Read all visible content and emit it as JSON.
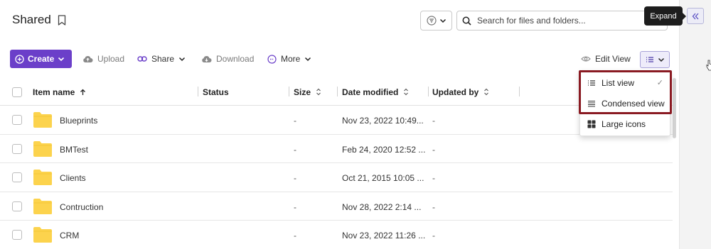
{
  "header": {
    "title": "Shared",
    "search_placeholder": "Search for files and folders...",
    "tooltip": "Expand"
  },
  "toolbar": {
    "create": "Create",
    "upload": "Upload",
    "share": "Share",
    "download": "Download",
    "more": "More",
    "edit_view": "Edit View"
  },
  "table": {
    "columns": [
      "Item name",
      "Status",
      "Size",
      "Date modified",
      "Updated by"
    ],
    "rows": [
      {
        "name": "Blueprints",
        "size": "-",
        "date": "Nov 23, 2022 10:49...",
        "updated_by": "-"
      },
      {
        "name": "BMTest",
        "size": "-",
        "date": "Feb 24, 2020 12:52 ...",
        "updated_by": "-"
      },
      {
        "name": "Clients",
        "size": "-",
        "date": "Oct 21, 2015 10:05 ...",
        "updated_by": "-"
      },
      {
        "name": "Contruction",
        "size": "-",
        "date": "Nov 28, 2022 2:14 ...",
        "updated_by": "-"
      },
      {
        "name": "CRM",
        "size": "-",
        "date": "Nov 23, 2022 11:26 ...",
        "updated_by": "-"
      }
    ]
  },
  "view_menu": {
    "items": [
      {
        "label": "List view",
        "icon": "list-icon",
        "selected": true
      },
      {
        "label": "Condensed view",
        "icon": "condensed-icon",
        "selected": false
      },
      {
        "label": "Large icons",
        "icon": "grid-icon",
        "selected": false
      }
    ],
    "check": "✓"
  },
  "colors": {
    "accent": "#6b3fc9",
    "folder": "#fcd34d",
    "highlight": "#8a1a22"
  }
}
